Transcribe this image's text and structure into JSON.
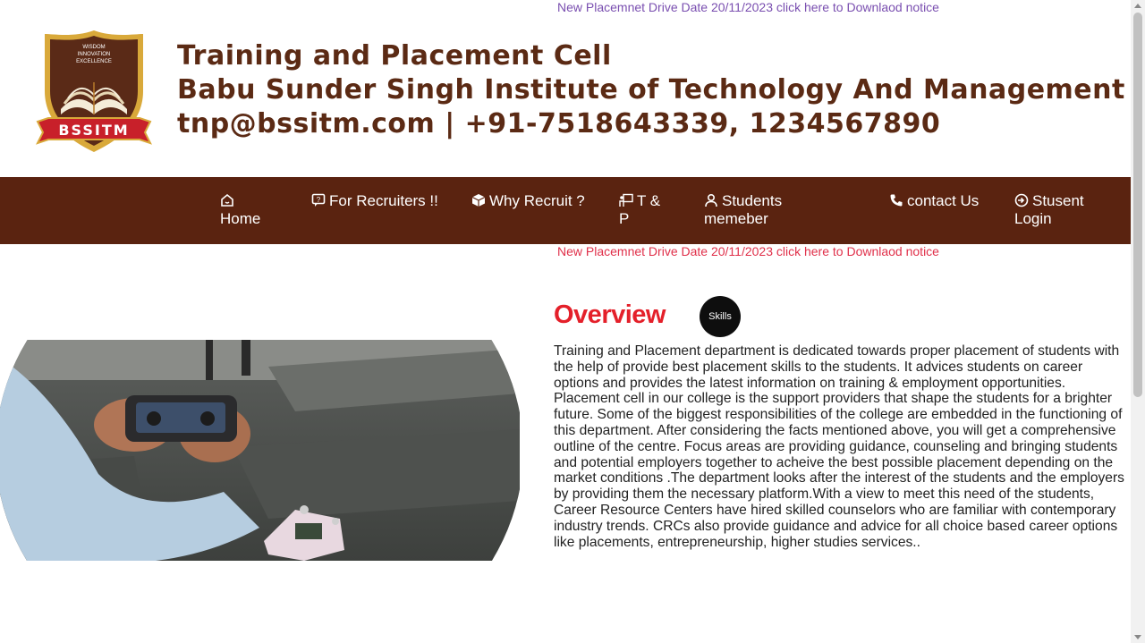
{
  "top_notice": "New Placemnet Drive Date 20/11/2023 click here to Downlaod notice",
  "logo": {
    "motto_lines": [
      "WISDOM",
      "INNOVATION",
      "EXCELLENCE"
    ],
    "banner": "BSSITM"
  },
  "header": {
    "line1": "Training and Placement Cell",
    "line2": "Babu Sunder Singh Institute of Technology And Management",
    "line3": "tnp@bssitm.com | +91-7518643339, 1234567890"
  },
  "nav": {
    "home": "Home",
    "recruiters": "For Recruiters !!",
    "why_recruit": "Why Recruit ?",
    "tp": "T & P",
    "students": "Students memeber",
    "contact": "contact Us",
    "login": "Stusent Login"
  },
  "sub_notice": "New Placemnet Drive Date 20/11/2023 click here to Downlaod notice",
  "overview": {
    "title": "Overview",
    "badge": "Skills",
    "body": "Training and Placement department is dedicated towards proper placement of students with the help of provide best placement skills to the students. It advices students on career options and provides the latest information on training & employment opportunities. Placement cell in our college is the support providers that shape the students for a brighter future. Some of the biggest responsibilities of the college are embedded in the functioning of this department. After considering the facts mentioned above, you will get a comprehensive outline of the centre. Focus areas are providing guidance, counseling and bringing students and potential employers together to acheive the best possible placement depending on the market conditions .The department looks after the interest of the students and the employers by providing them the necessary platform.With a view to meet this need of the students, Career Resource Centers have hired skilled counselors who are familiar with contemporary industry trends. CRCs also provide guidance and advice for all choice based career options like placements, entrepreneurship, higher studies services.."
  },
  "colors": {
    "brand_brown": "#5a2310",
    "heading_brown": "#5b2a14",
    "overview_red": "#e4202a",
    "notice_purple": "#7a4fb0",
    "notice_red": "#e0304a"
  }
}
